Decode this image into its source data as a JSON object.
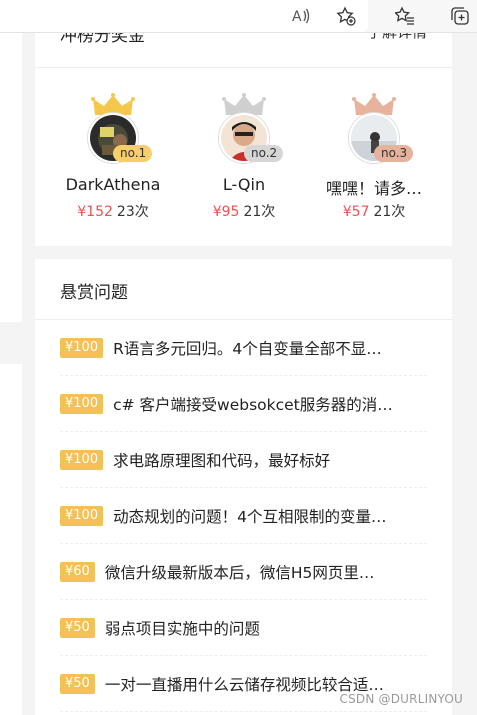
{
  "browser": {
    "icons": [
      "read-aloud-icon",
      "add-favorite-icon",
      "favorites-icon",
      "collections-icon"
    ]
  },
  "leaderboard": {
    "title": "冲榜分奖金",
    "more_label": "了解详情",
    "ranks": [
      {
        "name": "DarkAthena",
        "money": "¥152",
        "count": "23次",
        "badge": "no.1",
        "crown_color": "#f5c84c",
        "badge_color": "#f6cf6a"
      },
      {
        "name": "L-Qin",
        "money": "¥95",
        "count": "21次",
        "badge": "no.2",
        "crown_color": "#cfcfcf",
        "badge_color": "#d6d6d6"
      },
      {
        "name": "嘿嘿！请多…",
        "money": "¥57",
        "count": "21次",
        "badge": "no.3",
        "crown_color": "#e8b39c",
        "badge_color": "#e6b29c"
      }
    ]
  },
  "bounty": {
    "title": "悬赏问题",
    "items": [
      {
        "price": "¥100",
        "text": "R语言多元回归。4个自变量全部不显…"
      },
      {
        "price": "¥100",
        "text": "c# 客户端接受websokcet服务器的消…"
      },
      {
        "price": "¥100",
        "text": "求电路原理图和代码，最好标好"
      },
      {
        "price": "¥100",
        "text": "动态规划的问题！4个互相限制的变量…"
      },
      {
        "price": "¥60",
        "text": "微信升级最新版本后，微信H5网页里…"
      },
      {
        "price": "¥50",
        "text": "弱点项目实施中的问题"
      },
      {
        "price": "¥50",
        "text": "一对一直播用什么云储存视频比较合适…"
      }
    ]
  },
  "watermark": "CSDN @DURLINYOU"
}
